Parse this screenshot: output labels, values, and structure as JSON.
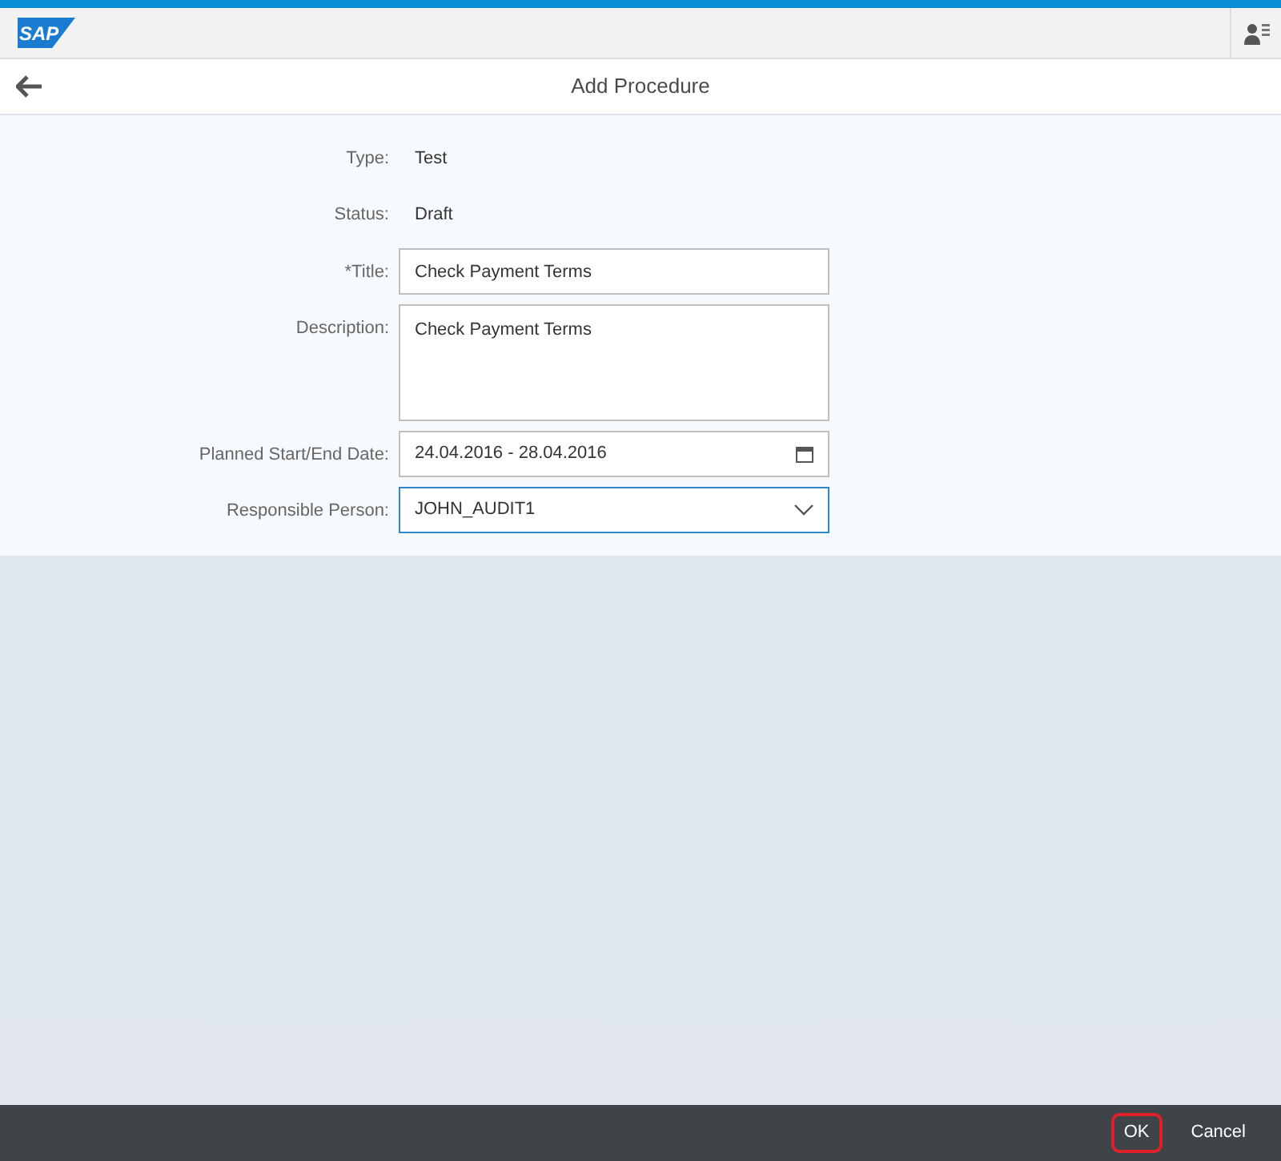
{
  "shell": {
    "logo": "SAP"
  },
  "page": {
    "title": "Add Procedure"
  },
  "form": [
    {
      "kind": "text",
      "label": "Type:",
      "value": "Test"
    },
    {
      "kind": "text",
      "label": "Status:",
      "value": "Draft"
    },
    {
      "kind": "input",
      "label": "*Title:",
      "value": "Check Payment Terms",
      "focused": false
    },
    {
      "kind": "textarea",
      "label": "Description:",
      "value": "Check Payment Terms",
      "focused": false
    },
    {
      "kind": "date",
      "label": "Planned Start/End Date:",
      "value": "24.04.2016 - 28.04.2016",
      "focused": false
    },
    {
      "kind": "select",
      "label": "Responsible Person:",
      "value": "JOHN_AUDIT1",
      "focused": true
    }
  ],
  "footer": {
    "buttons": [
      {
        "label": "OK",
        "highlighted": true
      },
      {
        "label": "Cancel",
        "highlighted": false
      }
    ]
  }
}
